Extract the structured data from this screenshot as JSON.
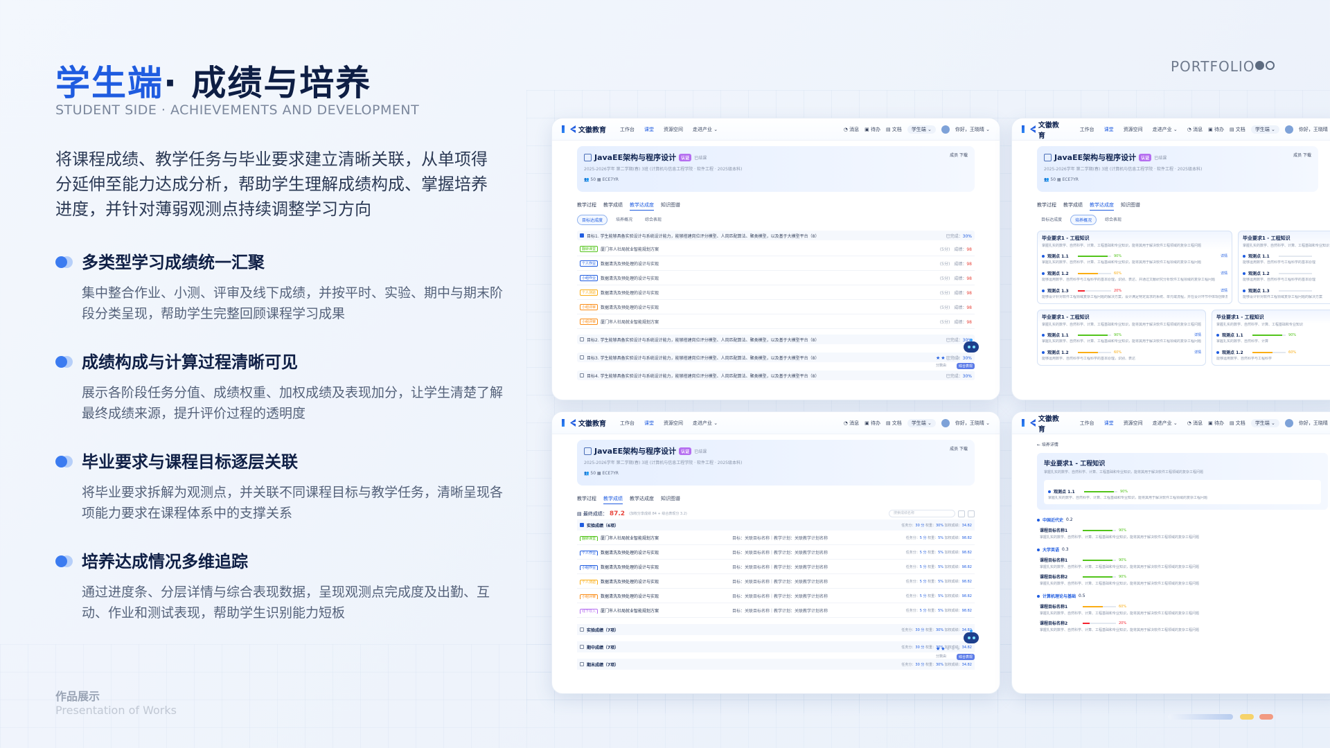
{
  "header": {
    "title_accent": "学生端",
    "title_main": "· 成绩与培养",
    "subtitle": "STUDENT SIDE · ACHIEVEMENTS AND DEVELOPMENT",
    "intro": "将课程成绩、教学任务与毕业要求建立清晰关联，从单项得分延伸至能力达成分析，帮助学生理解成绩构成、掌握培养进度，并针对薄弱观测点持续调整学习方向"
  },
  "portfolio": {
    "label": "PORTFOLIO"
  },
  "features": [
    {
      "title": "多类型学习成绩统一汇聚",
      "desc": "集中整合作业、小测、评审及线下成绩，并按平时、实验、期中与期末阶段分类呈现，帮助学生完整回顾课程学习成果"
    },
    {
      "title": "成绩构成与计算过程清晰可见",
      "desc": "展示各阶段任务分值、成绩权重、加权成绩及表现加分，让学生清楚了解最终成绩来源，提升评价过程的透明度"
    },
    {
      "title": "毕业要求与课程目标逐层关联",
      "desc": "将毕业要求拆解为观测点，并关联不同课程目标与教学任务，清晰呈现各项能力要求在课程体系中的支撑关系"
    },
    {
      "title": "培养达成情况多维追踪",
      "desc": "通过进度条、分层详情与综合表现数据，呈现观测点完成度及出勤、互动、作业和测试表现，帮助学生识别能力短板"
    }
  ],
  "footer": {
    "cn": "作品展示",
    "en": "Presentation of Works"
  },
  "colors": {
    "accent": "#1f5ce0",
    "navy": "#0e1e44",
    "score_red": "#e8453c",
    "bar_green": "#52c41a",
    "bar_orange": "#faad14",
    "bar_red": "#f5222d",
    "deco_blue": "#b9cdef",
    "deco_yellow": "#f6d36b",
    "deco_red": "#f29b82"
  },
  "app": {
    "logo": "文徽教育",
    "nav": [
      "工作台",
      "课堂",
      "资源空间",
      "走进产业 ⌄"
    ],
    "nav_right": [
      "消息",
      "待办",
      "文档",
      "学生端 ⌄",
      "你好，王晓晴 ⌄"
    ],
    "course_title": "JavaEE架构与程序设计",
    "course_tag": "认证",
    "course_status": "已结课",
    "course_meta": "2025-2026学年 第二学期(春)  3班 (计算机与信息工程学院 · 软件工程 · 2025级本科)",
    "course_people": "50",
    "course_code": "ECE7YR",
    "course_actions": "成员  下载",
    "tabs": [
      "教学过程",
      "教学成绩",
      "教学达成度",
      "知识图谱"
    ],
    "subtabs": [
      "目标达成度",
      "培养概况",
      "综合表现"
    ]
  },
  "shot1": {
    "goals": [
      "目标1. 学生能够具备实验设计与系统设计能力，能够搭建岗位评分模型、人岗匹配算法、聚类模型，以及基于大模型平台（8）",
      "目标2. 学生能够具备实验设计与系统设计能力，能够搭建岗位评分模型、人岗匹配算法、聚类模型，以及基于大模型平台（8）",
      "目标3. 学生能够具备实验设计与系统设计能力，能够搭建岗位评分模型、人岗匹配算法、聚类模型，以及基于大模型平台（8）",
      "目标4. 学生能够具备实验设计与系统设计能力，能够搭建岗位评分模型、人岗匹配算法、聚类模型，以及基于大模型平台（8）"
    ],
    "goal_values": [
      "已完成：30%",
      "已完成：30%",
      "已完成：30%",
      "已完成：30%"
    ],
    "rows": [
      {
        "tag": "翻转课堂",
        "text": "厦门市人社局就业智能规划方案",
        "sub": "(5分)",
        "score_label": "成绩：",
        "score": "98"
      },
      {
        "tag": "个人作业",
        "text": "数据清洗及预处理的设计与实现",
        "sub": "(5分)",
        "score_label": "成绩：",
        "score": "98"
      },
      {
        "tag": "小组作业",
        "text": "数据清洗及预处理的设计与实现",
        "sub": "(5分)",
        "score_label": "成绩：",
        "score": "98"
      },
      {
        "tag": "个人测验",
        "text": "数据清洗及预处理的设计与实现",
        "sub": "(5分)",
        "score_label": "成绩：",
        "score": "98"
      },
      {
        "tag": "小组评审",
        "text": "数据清洗及预处理的设计与实现",
        "sub": "(5分)",
        "score_label": "成绩：",
        "score": "98"
      },
      {
        "tag": "小组评审",
        "text": "厦门市人社局就业智能规划方案",
        "sub": "(5分)",
        "score_label": "成绩：",
        "score": "98"
      }
    ],
    "robot_caption": "分数由",
    "robot_badge": "综合表现"
  },
  "shot2": {
    "cards": [
      {
        "title": "毕业要求1 - 工程知识",
        "desc": "掌握扎实的数学、自然科学、计算、工程基础和专业知识，能将其用于解决软件工程领域的复杂工程问题",
        "obs": [
          {
            "name": "观测点 1.1",
            "pct_label": "90%",
            "pct": 90,
            "color": "#52c41a",
            "detail": "详情",
            "desc": "掌握扎实的数学、自然科学、计算、工程基础和专业知识，能将其用于解决软件工程领域的复杂工程问题"
          },
          {
            "name": "观测点 1.2",
            "pct_label": "60%",
            "pct": 60,
            "color": "#faad14",
            "detail": "详情",
            "desc": "能够运用数学、自然科学与工程科学的基本原理，识别、表达、并通过文献研究分析软件工程领域的复杂工程问题"
          },
          {
            "name": "观测点 1.3",
            "pct_label": "20%",
            "pct": 20,
            "color": "#f5222d",
            "detail": "详情",
            "desc": "能够设计针对软件工程领域复杂工程问题的解决方案，设计满足特定需求的系统、单元或流程，并在设计环节中体现创新意识"
          }
        ]
      },
      {
        "title": "毕业要求1 - 工程知识",
        "desc": "掌握扎实的数学、自然科学、计算、工程基础和专业知识",
        "obs": [
          {
            "name": "观测点 1.1",
            "pct_label": "",
            "pct": 0,
            "color": "#52c41a",
            "detail": "",
            "desc": "能够运用数学、自然科学与工程科学的基本原理"
          },
          {
            "name": "观测点 1.2",
            "pct_label": "",
            "pct": 0,
            "color": "#faad14",
            "detail": "",
            "desc": "能够运用数学、自然科学与工程科学的基本原理"
          },
          {
            "name": "观测点 1.3",
            "pct_label": "",
            "pct": 0,
            "color": "#f5222d",
            "detail": "",
            "desc": "能够设计针对软件工程领域复杂工程问题的解决方案"
          }
        ]
      }
    ],
    "cards2": [
      {
        "title": "毕业要求1 - 工程知识",
        "desc": "掌握扎实的数学、自然科学、计算、工程基础和专业知识，能将其用于解决软件工程领域的复杂工程问题",
        "obs": [
          {
            "name": "观测点 1.1",
            "pct_label": "90%",
            "pct": 90,
            "color": "#52c41a",
            "detail": "详情",
            "desc": "掌握扎实的数学、自然科学、计算、工程基础和专业知识，能将其用于解决软件工程领域的复杂工程问题"
          },
          {
            "name": "观测点 1.2",
            "pct_label": "60%",
            "pct": 60,
            "color": "#faad14",
            "detail": "详情",
            "desc": "能够运用数学、自然科学与工程科学的基本原理，识别、表达"
          }
        ]
      },
      {
        "title": "毕业要求1 - 工程知识",
        "desc": "掌握扎实的数学、自然科学、计算、工程基础和专业知识",
        "obs": [
          {
            "name": "观测点 1.1",
            "pct_label": "90%",
            "pct": 90,
            "color": "#52c41a",
            "detail": "",
            "desc": "掌握扎实的数学、自然科学、计算"
          },
          {
            "name": "观测点 1.2",
            "pct_label": "60%",
            "pct": 60,
            "color": "#faad14",
            "detail": "",
            "desc": "能够运用数学、自然科学与工程科学"
          }
        ]
      }
    ]
  },
  "shot3": {
    "final_label": "最终成绩：",
    "final_score": "87.2",
    "final_note": "(加权分享成绩 84 + 综合表现分 3.2)",
    "search_placeholder": "搜索成绩名称",
    "groups_top": {
      "name": "实验成绩（6项）",
      "meta1": "任务分：",
      "meta1v": "30 分",
      "meta2": "权重：",
      "meta2v": "30%",
      "meta3": "加权成绩：",
      "meta3v": "34.82"
    },
    "rows": [
      {
        "tag": "翻转课堂",
        "text": "厦门市人社局就业智能规划方案",
        "goal": "目标：关联目标名称｜教学计划：关联教学计划名称",
        "m1": "任务分：",
        "m1v": "5 分",
        "m2": "权重：",
        "m2v": "5%",
        "m3": "加权成绩：",
        "m3v": "98.82"
      },
      {
        "tag": "个人作业",
        "text": "数据清洗及预处理的设计与实现",
        "goal": "目标：关联目标名称｜教学计划：关联教学计划名称",
        "m1": "任务分：",
        "m1v": "5 分",
        "m2": "权重：",
        "m2v": "5%",
        "m3": "加权成绩：",
        "m3v": "98.82"
      },
      {
        "tag": "小组作业",
        "text": "数据清洗及预处理的设计与实现",
        "goal": "目标：关联目标名称｜教学计划：关联教学计划名称",
        "m1": "任务分：",
        "m1v": "5 分",
        "m2": "权重：",
        "m2v": "5%",
        "m3": "加权成绩：",
        "m3v": "98.82"
      },
      {
        "tag": "个人测验",
        "text": "数据清洗及预处理的设计与实现",
        "goal": "目标：关联目标名称｜教学计划：关联教学计划名称",
        "m1": "任务分：",
        "m1v": "5 分",
        "m2": "权重：",
        "m2v": "5%",
        "m3": "加权成绩：",
        "m3v": "98.82"
      },
      {
        "tag": "小组评审",
        "text": "数据清洗及预处理的设计与实现",
        "goal": "目标：关联目标名称｜教学计划：关联教学计划名称",
        "m1": "任务分：",
        "m1v": "5 分",
        "m2": "权重：",
        "m2v": "5%",
        "m3": "加权成绩：",
        "m3v": "98.82"
      },
      {
        "tag": "线下导入",
        "text": "厦门市人社局就业智能规划方案",
        "goal": "目标：关联目标名称｜教学计划：关联教学计划名称",
        "m1": "任务分：",
        "m1v": "5 分",
        "m2": "权重：",
        "m2v": "5%",
        "m3": "加权成绩：",
        "m3v": "98.82"
      }
    ],
    "groups_bottom": [
      {
        "name": "实验成绩（7项）",
        "meta1": "任务分：",
        "meta1v": "30 分",
        "meta2": "权重：",
        "meta2v": "30%",
        "meta3": "加权成绩：",
        "meta3v": "34.82"
      },
      {
        "name": "期中成绩（7项）",
        "meta1": "任务分：",
        "meta1v": "30 分",
        "meta2": "权重：",
        "meta2v": "30%",
        "meta3": "加权成绩：",
        "meta3v": "34.82"
      },
      {
        "name": "期末成绩（7项）",
        "meta1": "任务分：",
        "meta1v": "30 分",
        "meta2": "权重：",
        "meta2v": "30%",
        "meta3": "加权成绩：",
        "meta3v": "34.82"
      }
    ]
  },
  "shot4": {
    "back": "← 培养详情",
    "req_title": "毕业要求1 - 工程知识",
    "req_desc": "掌握扎实的数学、自然科学、计算、工程基础和专业知识，能将其用于解决软件工程领域的复杂工程问题",
    "req_obs": {
      "name": "观测点 1.1",
      "pct_label": "90%",
      "pct": 90,
      "color": "#52c41a",
      "desc": "掌握扎实的数学、自然科学、计算、工程基础和专业知识，能将其用于解决软件工程领域的复杂工程问题"
    },
    "courses": [
      {
        "name": "中国近代史",
        "weight": "0.2",
        "subs": [
          {
            "name": "课程目标名称1",
            "pct_label": "90%",
            "pct": 90,
            "color": "#52c41a",
            "desc": "掌握扎实的数学、自然科学、计算、工程基础和专业知识，能将其用于解决软件工程领域的复杂工程问题"
          }
        ]
      },
      {
        "name": "大学英语",
        "weight": "0.3",
        "subs": [
          {
            "name": "课程目标名称1",
            "pct_label": "90%",
            "pct": 90,
            "color": "#52c41a",
            "desc": "掌握扎实的数学、自然科学、计算、工程基础和专业知识，能将其用于解决软件工程领域的复杂工程问题"
          },
          {
            "name": "课程目标名称2",
            "pct_label": "90%",
            "pct": 90,
            "color": "#52c41a",
            "desc": "掌握扎实的数学、自然科学、计算、工程基础和专业知识，能将其用于解决软件工程领域的复杂工程问题"
          }
        ]
      },
      {
        "name": "计算机理论与基础",
        "weight": "0.5",
        "subs": [
          {
            "name": "课程目标名称1",
            "pct_label": "60%",
            "pct": 60,
            "color": "#faad14",
            "desc": "掌握扎实的数学、自然科学、计算、工程基础和专业知识，能将其用于解决软件工程领域的复杂工程问题"
          },
          {
            "name": "课程目标名称2",
            "pct_label": "20%",
            "pct": 20,
            "color": "#f5222d",
            "desc": "掌握扎实的数学、自然科学、计算、工程基础和专业知识，能将其用于解决软件工程领域的复杂工程问题"
          }
        ]
      }
    ]
  }
}
